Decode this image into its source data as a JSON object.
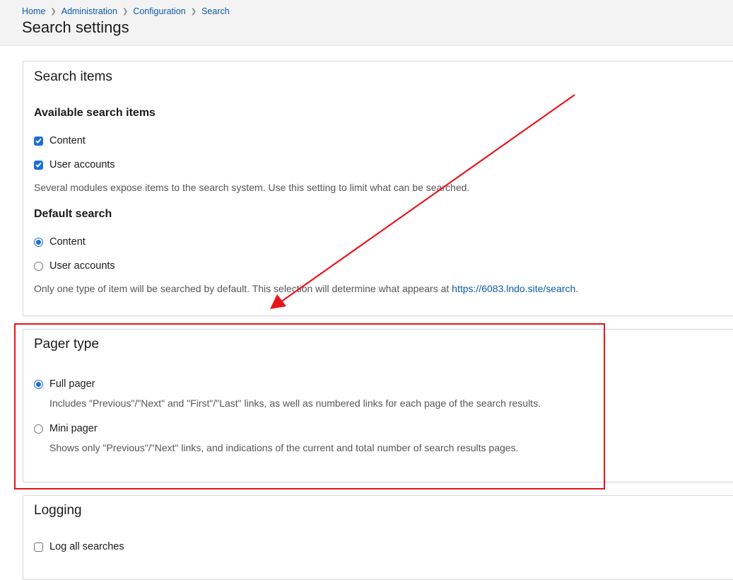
{
  "breadcrumb": [
    {
      "label": "Home"
    },
    {
      "label": "Administration"
    },
    {
      "label": "Configuration"
    },
    {
      "label": "Search"
    }
  ],
  "page_title": "Search settings",
  "search_items": {
    "title": "Search items",
    "available": {
      "heading": "Available search items",
      "options": [
        {
          "label": "Content",
          "checked": true
        },
        {
          "label": "User accounts",
          "checked": true
        }
      ],
      "description": "Several modules expose items to the search system. Use this setting to limit what can be searched."
    },
    "default": {
      "heading": "Default search",
      "options": [
        {
          "label": "Content",
          "selected": true
        },
        {
          "label": "User accounts",
          "selected": false
        }
      ],
      "description_prefix": "Only one type of item will be searched by default. This selection will determine what appears at ",
      "link": "https://6083.lndo.site/search",
      "description_suffix": "."
    }
  },
  "pager_type": {
    "title": "Pager type",
    "options": [
      {
        "label": "Full pager",
        "selected": true,
        "description": "Includes \"Previous\"/\"Next\" and \"First\"/\"Last\" links, as well as numbered links for each page of the search results."
      },
      {
        "label": "Mini pager",
        "selected": false,
        "description": "Shows only \"Previous\"/\"Next\" links, and indications of the current and total number of search results pages."
      }
    ]
  },
  "logging": {
    "title": "Logging",
    "option_label": "Log all searches",
    "checked": false
  },
  "colors": {
    "link": "#0f5bab",
    "accent": "#1a6fd9",
    "annotation": "#e8141b"
  }
}
